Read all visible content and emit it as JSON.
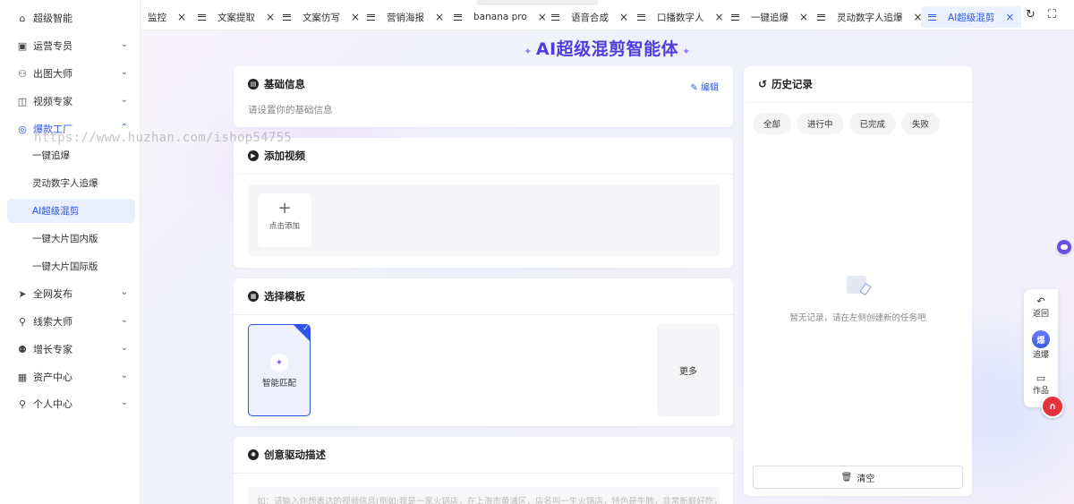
{
  "sidebar": {
    "items": [
      {
        "label": "超级智能",
        "icon": "home-icon"
      },
      {
        "label": "运营专员",
        "icon": "ops-icon"
      },
      {
        "label": "出图大师",
        "icon": "image-user-icon"
      },
      {
        "label": "视频专家",
        "icon": "video-icon"
      },
      {
        "label": "爆款工厂",
        "icon": "factory-icon"
      },
      {
        "label": "全网发布",
        "icon": "send-icon"
      },
      {
        "label": "线索大师",
        "icon": "lead-icon"
      },
      {
        "label": "增长专家",
        "icon": "growth-icon"
      },
      {
        "label": "资产中心",
        "icon": "asset-icon"
      },
      {
        "label": "个人中心",
        "icon": "user-icon"
      }
    ],
    "subitems": [
      {
        "label": "一键追爆"
      },
      {
        "label": "灵动数字人追爆"
      },
      {
        "label": "AI超级混剪"
      },
      {
        "label": "一键大片国内版"
      },
      {
        "label": "一键大片国际版"
      }
    ]
  },
  "watermark": "https://www.huzhan.com/ishop54755",
  "tabs": [
    {
      "label": "监控"
    },
    {
      "label": "文案提取"
    },
    {
      "label": "文案仿写"
    },
    {
      "label": "营销海报"
    },
    {
      "label": "banana pro"
    },
    {
      "label": "语音合成"
    },
    {
      "label": "口播数字人"
    },
    {
      "label": "一键追爆"
    },
    {
      "label": "灵动数字人追爆"
    },
    {
      "label": "AI超级混剪"
    }
  ],
  "tab_close": "×",
  "tab_tools": {
    "refresh": "↻",
    "fullscreen": "⛶"
  },
  "page": {
    "title": "AI超级混剪智能体",
    "sparkle": "✦"
  },
  "basic_info": {
    "title": "基础信息",
    "edit_label": "编辑",
    "hint": "请设置你的基础信息"
  },
  "add_video": {
    "title": "添加视频",
    "upload_plus": "+",
    "upload_label": "点击添加"
  },
  "template": {
    "title": "选择模板",
    "selected_label": "智能匹配",
    "more_label": "更多",
    "check": "✓",
    "spark": "✦"
  },
  "creative": {
    "title": "创意驱动描述",
    "placeholder": "如：请输入你想表达的视频信息(例如:我是一家火锅店，在上海市黄浦区，店名叫一生火锅店，特色是牛肺，非常新鲜好吃，三人"
  },
  "history": {
    "title": "历史记录",
    "filters": [
      "全部",
      "进行中",
      "已完成",
      "失败"
    ],
    "empty_text": "暂无记录，请在左侧创建新的任务吧",
    "clear_label": "清空"
  },
  "float_panel": {
    "back": "返回",
    "chase": "追爆",
    "chase_badge": "爆",
    "works": "作品"
  },
  "colors": {
    "accent": "#2f54eb",
    "title": "#4f3de0",
    "red": "#e6323c"
  }
}
